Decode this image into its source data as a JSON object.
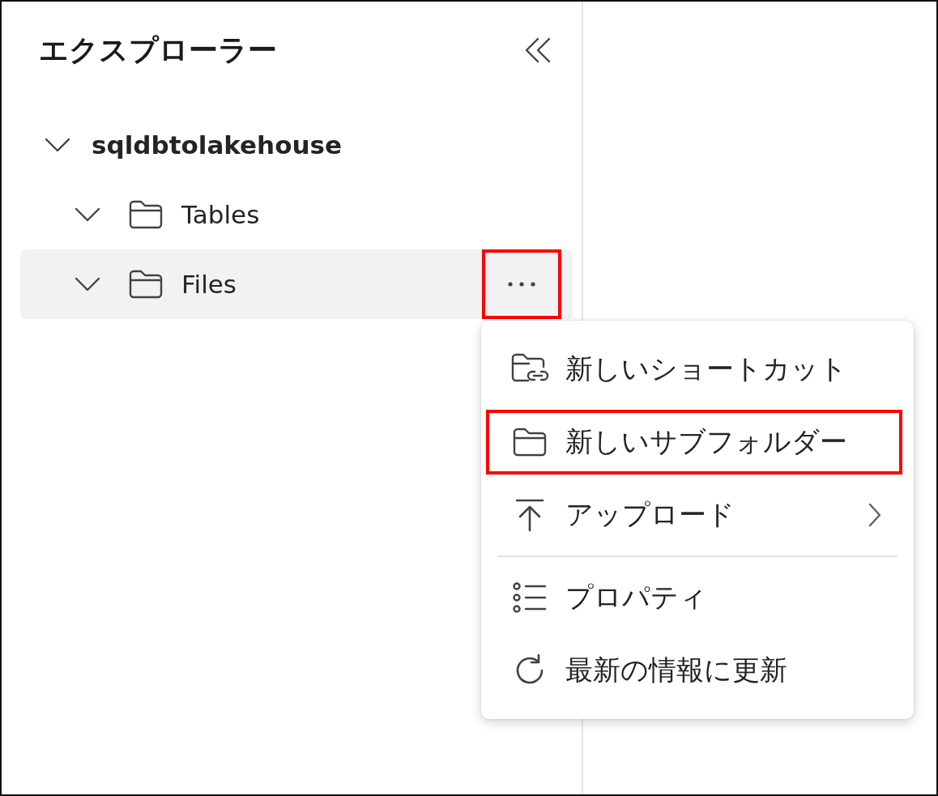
{
  "explorer": {
    "title": "エクスプローラー",
    "tree": [
      {
        "label": "sqldbtolakehouse",
        "kind": "root",
        "expanded": true,
        "selected": false,
        "children": [
          {
            "label": "Tables",
            "kind": "folder",
            "expanded": true,
            "selected": false
          },
          {
            "label": "Files",
            "kind": "folder",
            "expanded": true,
            "selected": true,
            "more_button": {
              "highlighted": true
            }
          }
        ]
      }
    ]
  },
  "context_menu": {
    "items": [
      {
        "label": "新しいショートカット",
        "kind": "shortcut",
        "highlighted": false,
        "has_submenu": false,
        "divider_before": false
      },
      {
        "label": "新しいサブフォルダー",
        "kind": "folder",
        "highlighted": true,
        "has_submenu": false,
        "divider_before": false
      },
      {
        "label": "アップロード",
        "kind": "upload",
        "highlighted": false,
        "has_submenu": true,
        "divider_before": false
      },
      {
        "label": "プロパティ",
        "kind": "properties",
        "highlighted": false,
        "has_submenu": false,
        "divider_before": true
      },
      {
        "label": "最新の情報に更新",
        "kind": "refresh",
        "highlighted": false,
        "has_submenu": false,
        "divider_before": false
      }
    ]
  }
}
